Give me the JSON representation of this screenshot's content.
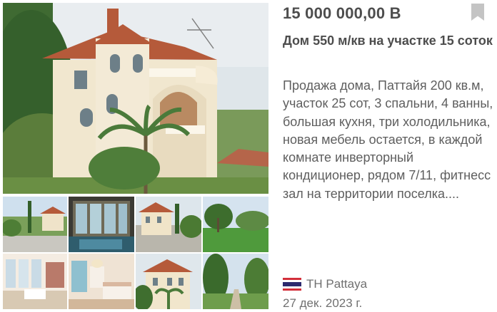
{
  "listing": {
    "price": "15 000 000,00 В",
    "title": "Дом 550 м/кв на участке 15 соток",
    "description": "Продажа дома, Паттайя 200 кв.м, участок 25 сот, 3 спальни, 4 ванны, большая кухня, три холодильника, новая мебель остается, в каждой комнате инверторный кондиционер, рядом 7/11, фитнесс зал на территории поселка....",
    "location": {
      "country_code": "TH",
      "city": "Pattaya",
      "flag_icon": "thailand-flag-icon"
    },
    "date": "27 дек. 2023 г.",
    "bookmark_icon": "bookmark-icon"
  },
  "gallery": {
    "photos": [
      {
        "name": "main-photo",
        "subject": "villa-exterior"
      },
      {
        "name": "thumbnail-1",
        "subject": "garden-yard"
      },
      {
        "name": "thumbnail-2",
        "subject": "covered-pool"
      },
      {
        "name": "thumbnail-3",
        "subject": "villa-exterior"
      },
      {
        "name": "thumbnail-4",
        "subject": "lawn-garden"
      },
      {
        "name": "thumbnail-5",
        "subject": "living-room"
      },
      {
        "name": "thumbnail-6",
        "subject": "bedroom"
      },
      {
        "name": "thumbnail-7",
        "subject": "villa-exterior"
      },
      {
        "name": "thumbnail-8",
        "subject": "garden-path"
      }
    ]
  },
  "colors": {
    "text_primary": "#4d4d4d",
    "text_secondary": "#707070",
    "bookmark": "#c4c4c4",
    "flag_red": "#d32f3a",
    "flag_blue": "#2d2a6e"
  }
}
